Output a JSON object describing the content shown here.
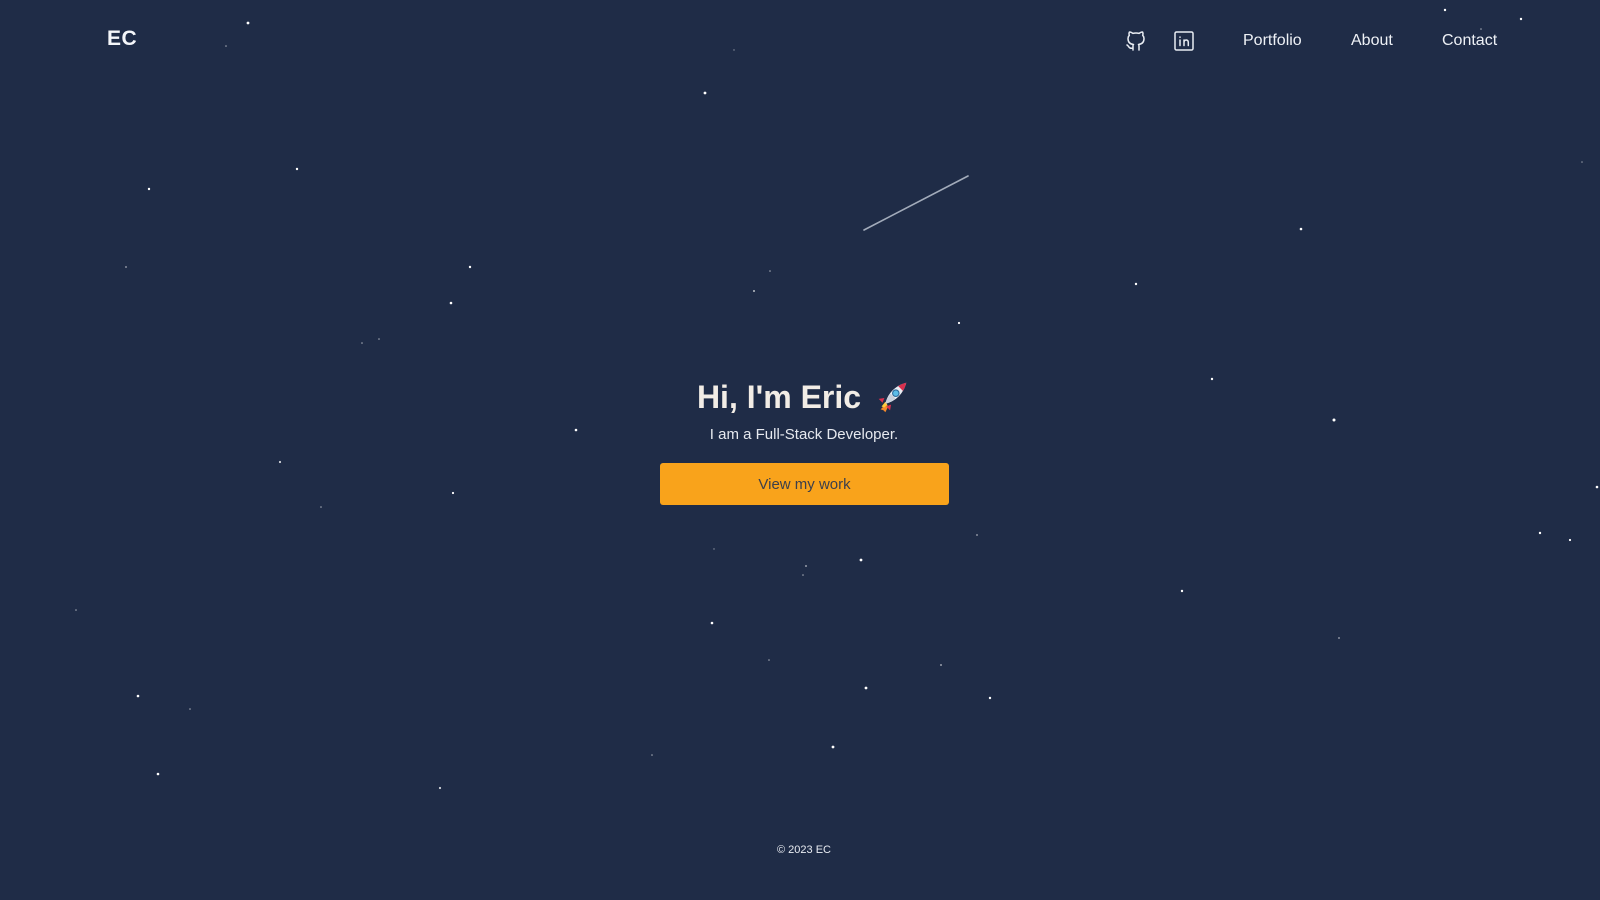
{
  "header": {
    "logo": "EC",
    "icons": [
      "github-icon",
      "linkedin-icon"
    ],
    "nav": [
      "Portfolio",
      "About",
      "Contact"
    ]
  },
  "hero": {
    "title": "Hi, I'm Eric",
    "title_icon": "rocket-icon",
    "subtitle": "I am a Full-Stack Developer.",
    "cta_label": "View my work"
  },
  "footer": {
    "text": "© 2023 EC"
  },
  "colors": {
    "background": "#1f2c47",
    "accent": "#f9a31b",
    "text": "#eef1f6"
  }
}
